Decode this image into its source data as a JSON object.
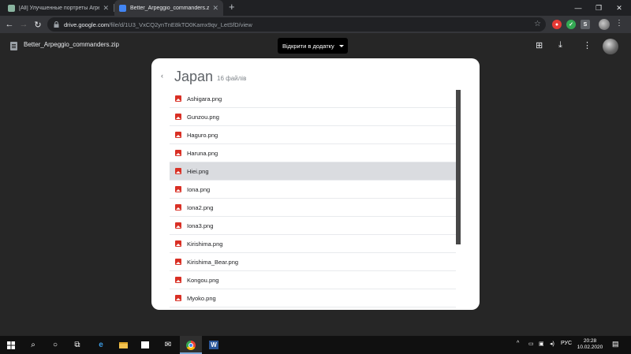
{
  "browser": {
    "tabs": [
      {
        "title": "[All] Улучшенные портреты Arpe",
        "favicon_color": "#8ab4a0"
      },
      {
        "title": "Better_Arpeggio_commanders.zi",
        "favicon_color": "#4285f4"
      }
    ],
    "new_tab": "+",
    "window_controls": [
      "—",
      "❐",
      "✕"
    ],
    "url_host": "drive.google.com",
    "url_path": "/file/d/1U3_VxCQ2ynTnE8kTO0Kamx9qv_LetSfD/view",
    "extensions": [
      {
        "name": "ext-red",
        "color": "#e53935",
        "glyph": "●"
      },
      {
        "name": "ext-shield",
        "color": "#34a853",
        "glyph": "✓"
      },
      {
        "name": "ext-s",
        "color": "#5f6368",
        "glyph": "S"
      }
    ]
  },
  "viewer": {
    "file_name": "Better_Arpeggio_commanders.zip",
    "open_with_label": "Відкрити в додатку",
    "folder": {
      "name": "Japan",
      "count_label": "16 файлів",
      "files": [
        {
          "name": "Ashigara.png",
          "selected": false
        },
        {
          "name": "Gunzou.png",
          "selected": false
        },
        {
          "name": "Haguro.png",
          "selected": false
        },
        {
          "name": "Haruna.png",
          "selected": false
        },
        {
          "name": "Hiei.png",
          "selected": true
        },
        {
          "name": "Iona.png",
          "selected": false
        },
        {
          "name": "Iona2.png",
          "selected": false
        },
        {
          "name": "Iona3.png",
          "selected": false
        },
        {
          "name": "Kirishima.png",
          "selected": false
        },
        {
          "name": "Kirishima_Bear.png",
          "selected": false
        },
        {
          "name": "Kongou.png",
          "selected": false
        },
        {
          "name": "Myoko.png",
          "selected": false
        }
      ]
    }
  },
  "taskbar": {
    "language": "РУС",
    "time": "20:28",
    "date": "10.02.2020"
  },
  "colors": {
    "viewer_bg": "#262626",
    "selected_row": "#dadce0",
    "image_icon": "#d93025"
  }
}
